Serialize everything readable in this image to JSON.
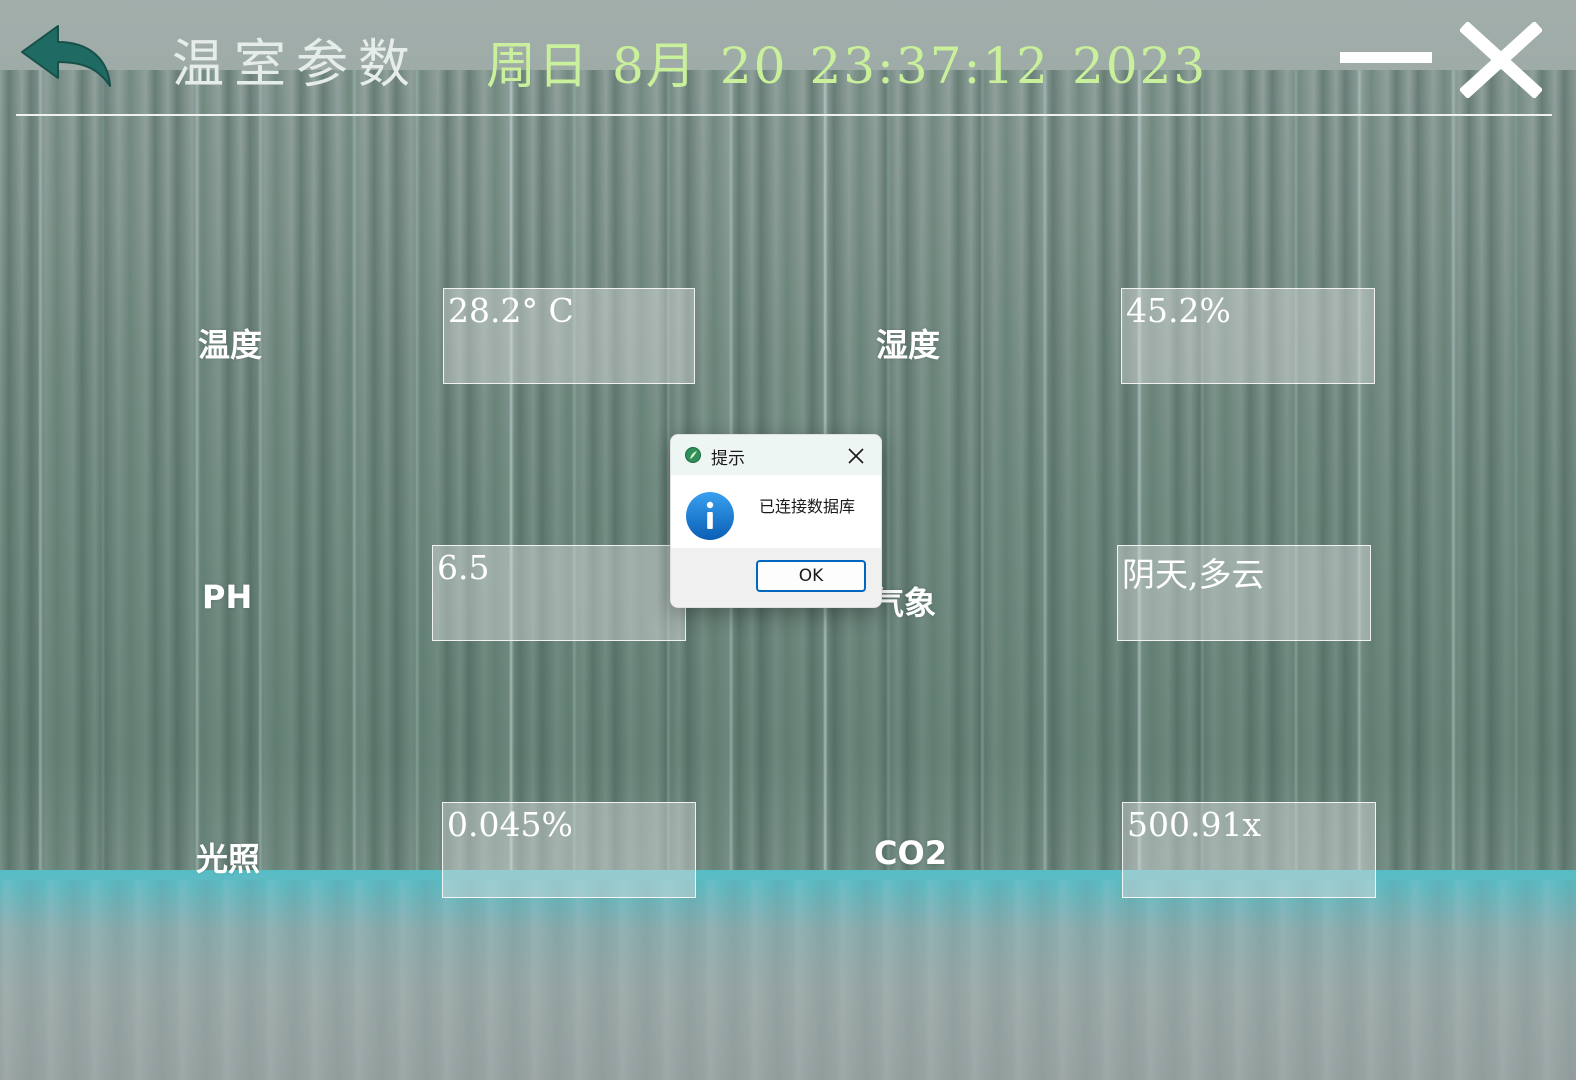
{
  "window": {
    "title": "温室参数",
    "datetime": {
      "weekday": "周日",
      "month": "8月",
      "day": "20",
      "time": "23:37:12",
      "year": "2023"
    },
    "colors": {
      "title": "#e6ecea",
      "datetime": "#c9f09a",
      "back_icon": "#1f6b63"
    },
    "icons": {
      "back": "back-arrow-icon",
      "minimize": "minimize-icon",
      "close": "close-icon"
    }
  },
  "parameters": [
    {
      "id": "temperature",
      "label": "温度",
      "value": "28.2° C"
    },
    {
      "id": "humidity",
      "label": "湿度",
      "value": "45.2%"
    },
    {
      "id": "ph",
      "label": "PH",
      "value": "6.5"
    },
    {
      "id": "weather",
      "label": "气象",
      "value": "阴天,多云"
    },
    {
      "id": "light",
      "label": "光照",
      "value": "0.045%"
    },
    {
      "id": "co2",
      "label": "CO2",
      "value": "500.91x"
    }
  ],
  "dialog": {
    "title": "提示",
    "message": "已连接数据库",
    "ok_label": "OK",
    "icon": "info-icon",
    "accent": "#0067c0"
  }
}
